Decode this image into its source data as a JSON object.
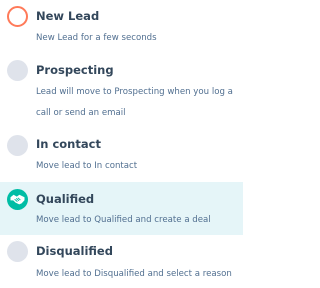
{
  "stages": [
    {
      "title": "New Lead",
      "description": "New Lead for a few seconds",
      "marker_icon": "ring-icon",
      "marker_color": "#ff7a59"
    },
    {
      "title": "Prospecting",
      "description_line1": "Lead will move to Prospecting when you log a",
      "description_line2": "call or send an email",
      "marker_icon": "empty-circle-icon",
      "marker_color": "#dfe3eb"
    },
    {
      "title": "In contact",
      "description": "Move lead to In contact",
      "marker_icon": "empty-circle-icon",
      "marker_color": "#dfe3eb"
    },
    {
      "title": "Qualified",
      "description": "Move lead to Qualified and create a deal",
      "marker_icon": "handshake-icon",
      "marker_color": "#00bda5",
      "selected": true
    },
    {
      "title": "Disqualified",
      "description": "Move lead to Disqualified and select a reason",
      "marker_icon": "empty-circle-icon",
      "marker_color": "#dfe3eb"
    }
  ],
  "colors": {
    "title_text": "#33475b",
    "description_text": "#516f90",
    "selected_background": "#e5f5f8"
  }
}
